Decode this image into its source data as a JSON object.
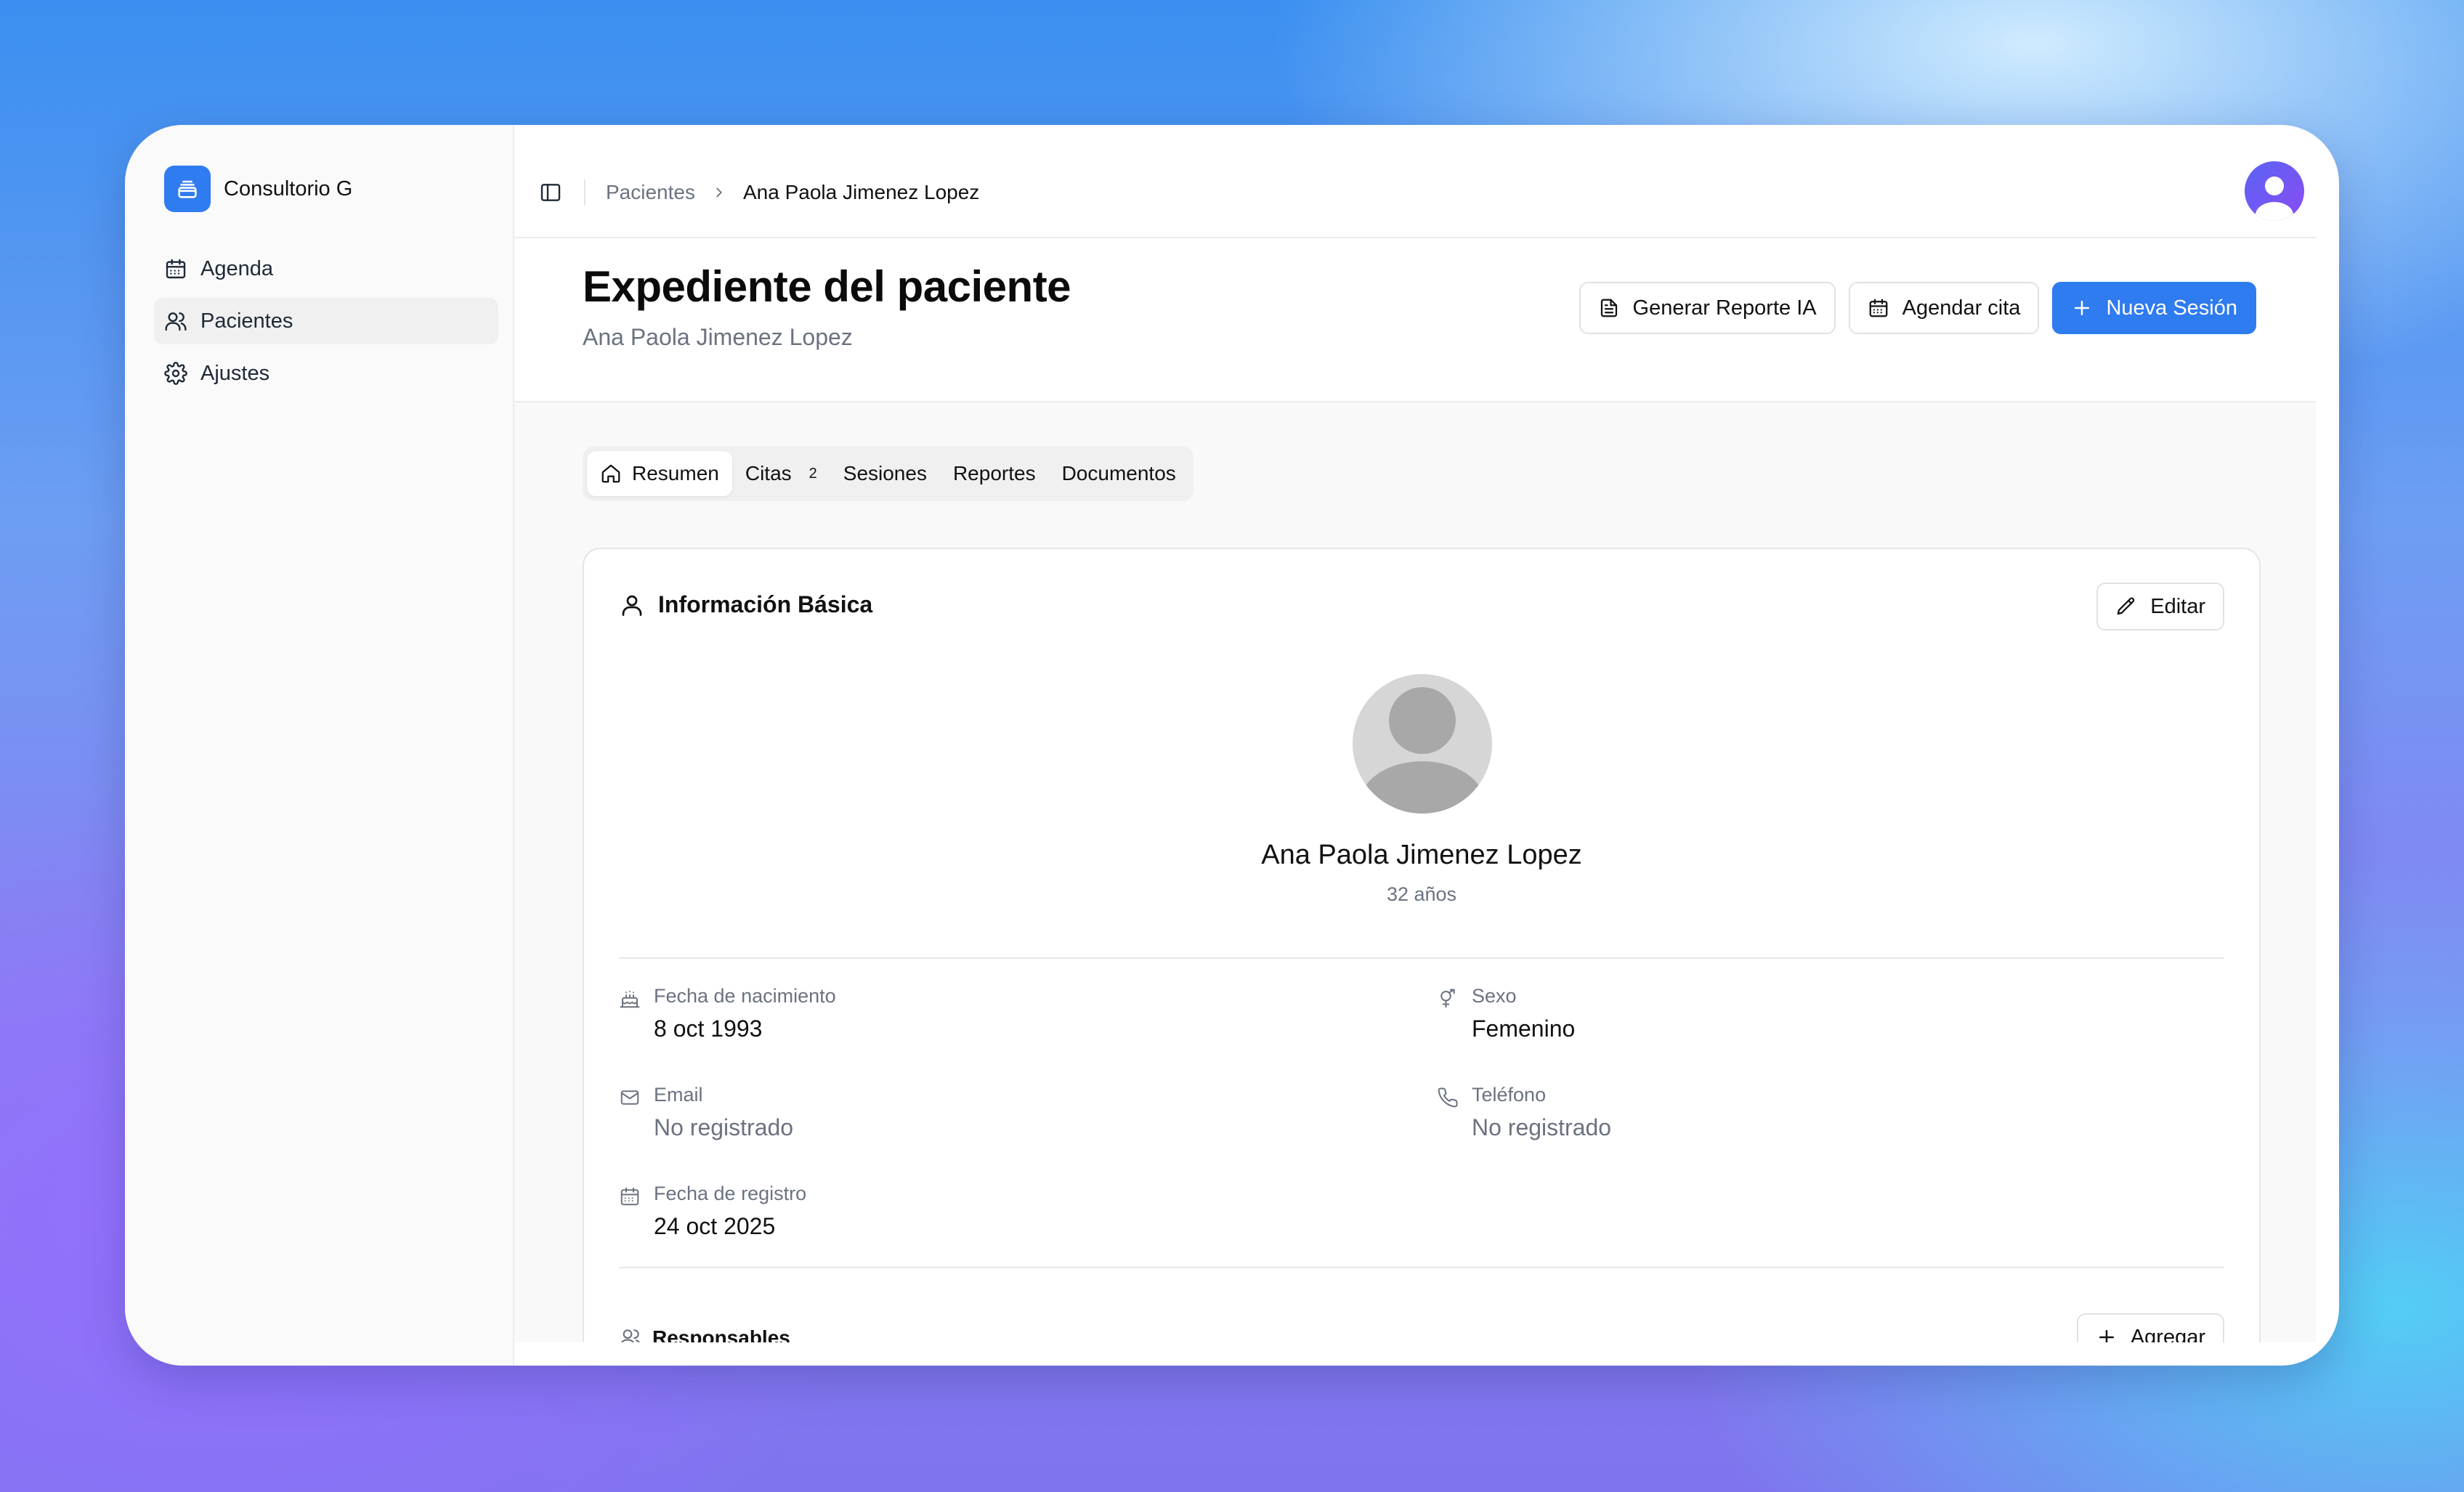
{
  "app": {
    "name": "Consultorio G"
  },
  "sidebar": {
    "items": [
      {
        "label": "Agenda",
        "icon": "calendar-icon",
        "active": false
      },
      {
        "label": "Pacientes",
        "icon": "users-icon",
        "active": true
      },
      {
        "label": "Ajustes",
        "icon": "gear-icon",
        "active": false
      }
    ]
  },
  "breadcrumb": {
    "parent": "Pacientes",
    "current": "Ana Paola Jimenez Lopez"
  },
  "header": {
    "title": "Expediente del paciente",
    "subtitle": "Ana Paola Jimenez Lopez",
    "buttons": {
      "report": "Generar Reporte IA",
      "schedule": "Agendar cita",
      "new_session": "Nueva Sesión"
    }
  },
  "tabs": [
    {
      "label": "Resumen",
      "active": true
    },
    {
      "label": "Citas",
      "badge": "2"
    },
    {
      "label": "Sesiones"
    },
    {
      "label": "Reportes"
    },
    {
      "label": "Documentos"
    }
  ],
  "basic_info": {
    "title": "Información Básica",
    "edit_label": "Editar",
    "patient_name": "Ana Paola Jimenez Lopez",
    "age": "32 años",
    "fields": {
      "birth": {
        "label": "Fecha de nacimiento",
        "value": "8 oct 1993"
      },
      "sex": {
        "label": "Sexo",
        "value": "Femenino"
      },
      "email": {
        "label": "Email",
        "value": "No registrado"
      },
      "phone": {
        "label": "Teléfono",
        "value": "No registrado"
      },
      "registered": {
        "label": "Fecha de registro",
        "value": "24 oct 2025"
      }
    }
  },
  "responsables": {
    "title": "Responsables",
    "add_label": "Agregar"
  },
  "colors": {
    "accent": "#2f7bf0",
    "muted": "#6b7280",
    "avatar_gradient_start": "#5a63f5",
    "avatar_gradient_end": "#8b4cf2"
  }
}
